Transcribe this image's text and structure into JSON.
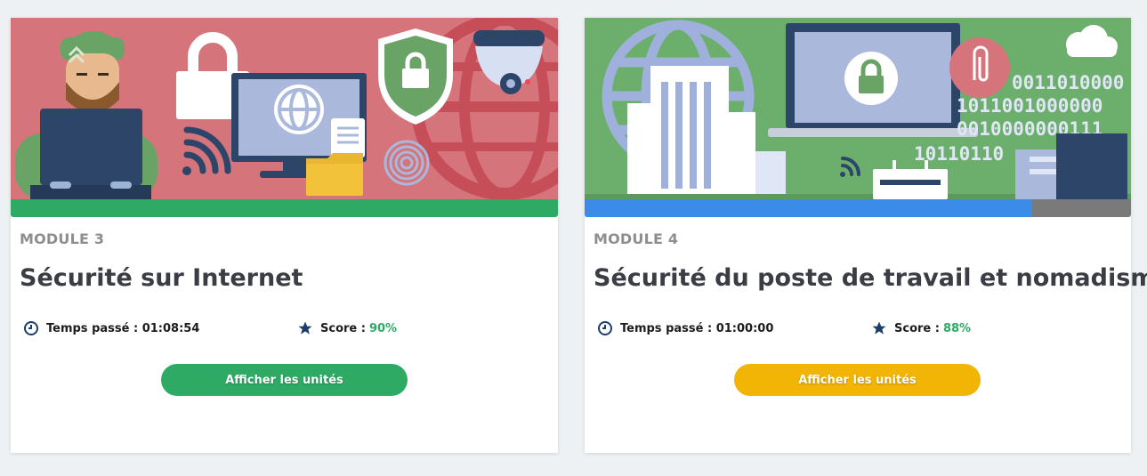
{
  "theme": {
    "green": "#2eaa65",
    "blue": "#3b8be8",
    "yellow": "#f2b506",
    "gray_track": "#7a7a7a"
  },
  "modules": [
    {
      "module_label": "MODULE 3",
      "title": "Sécurité sur Internet",
      "time_label": "Temps passé :",
      "time_value": "01:08:54",
      "score_label": "Score :",
      "score_value": "90%",
      "button_label": "Afficher les unités",
      "button_color": "#2eaa65",
      "progress_fraction": 1.0,
      "progress_color": "#2eaa65",
      "banner_bg": "#d6747c",
      "icons": [
        "hacker-icon",
        "lock-icon",
        "monitor-globe-icon",
        "shield-lock-icon",
        "security-camera-icon",
        "wifi-icon",
        "folder-icon",
        "fingerprint-icon",
        "globe-icon"
      ]
    },
    {
      "module_label": "MODULE 4",
      "title": "Sécurité du poste de travail et nomadisme",
      "time_label": "Temps passé :",
      "time_value": "01:00:00",
      "score_label": "Score :",
      "score_value": "88%",
      "button_label": "Afficher les unités",
      "button_color": "#f2b506",
      "progress_fraction": 0.82,
      "progress_color": "#3b8be8",
      "banner_bg": "#6cae6b",
      "binary_text": [
        "0011010000",
        "1011001000000",
        "0010000000111",
        "10110110"
      ],
      "icons": [
        "globe-icon",
        "buildings-icon",
        "laptop-lock-icon",
        "paperclip-icon",
        "cloud-icon",
        "router-icon",
        "wifi-icon"
      ]
    }
  ]
}
